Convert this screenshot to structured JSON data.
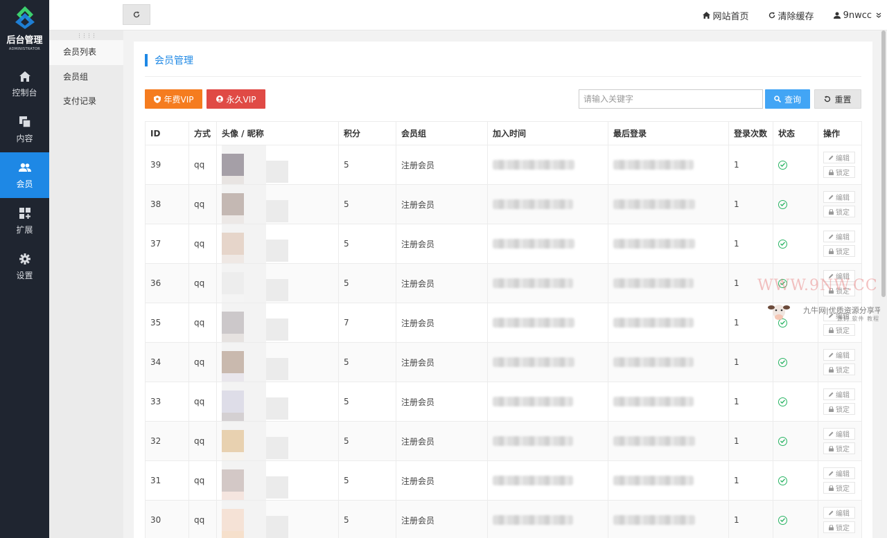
{
  "sidebar": {
    "logo_title": "后台管理",
    "logo_subtitle": "ADMINISTRATOR",
    "items": [
      {
        "label": "控制台",
        "icon": "home-icon"
      },
      {
        "label": "内容",
        "icon": "content-icon"
      },
      {
        "label": "会员",
        "icon": "users-icon",
        "active": true
      },
      {
        "label": "扩展",
        "icon": "extend-icon"
      },
      {
        "label": "设置",
        "icon": "gear-icon"
      }
    ]
  },
  "subnav": {
    "items": [
      {
        "label": "会员列表",
        "active": true
      },
      {
        "label": "会员组"
      },
      {
        "label": "支付记录"
      }
    ]
  },
  "topbar": {
    "home_label": "网站首页",
    "clear_cache_label": "清除缓存",
    "username": "9nwcc"
  },
  "page": {
    "title": "会员管理",
    "btn_year_vip": "年费VIP",
    "btn_perm_vip": "永久VIP",
    "search_placeholder": "请输入关键字",
    "btn_query": "查询",
    "btn_reset": "重置"
  },
  "table": {
    "headers": [
      "ID",
      "方式",
      "头像 / 昵称",
      "积分",
      "会员组",
      "加入时间",
      "最后登录",
      "登录次数",
      "状态",
      "操作"
    ],
    "edit_label": "编辑",
    "lock_label": "锁定",
    "rows": [
      {
        "id": "39",
        "method": "qq",
        "points": "5",
        "group": "注册会员",
        "logins": "1",
        "avatar_color": "#a59fa7",
        "avatar_color2": "#e8e4e2"
      },
      {
        "id": "38",
        "method": "qq",
        "points": "5",
        "group": "注册会员",
        "logins": "1",
        "avatar_color": "#c4b8b3",
        "avatar_color2": "#ece8e6"
      },
      {
        "id": "37",
        "method": "qq",
        "points": "5",
        "group": "注册会员",
        "logins": "1",
        "avatar_color": "#e6d5ca",
        "avatar_color2": "#efe8e4"
      },
      {
        "id": "36",
        "method": "qq",
        "points": "5",
        "group": "注册会员",
        "logins": "1",
        "avatar_color": "#ededed",
        "avatar_color2": "#f4f4f4"
      },
      {
        "id": "35",
        "method": "qq",
        "points": "7",
        "group": "注册会员",
        "logins": "1",
        "avatar_color": "#ccc8ca",
        "avatar_color2": "#e6e2e0"
      },
      {
        "id": "34",
        "method": "qq",
        "points": "5",
        "group": "注册会员",
        "logins": "1",
        "avatar_color": "#c9b9ae",
        "avatar_color2": "#e9e6ec"
      },
      {
        "id": "33",
        "method": "qq",
        "points": "5",
        "group": "注册会员",
        "logins": "1",
        "avatar_color": "#dedde8",
        "avatar_color2": "#d4d0d2"
      },
      {
        "id": "32",
        "method": "qq",
        "points": "5",
        "group": "注册会员",
        "logins": "1",
        "avatar_color": "#e8d1b0",
        "avatar_color2": "#f6f3ee"
      },
      {
        "id": "31",
        "method": "qq",
        "points": "5",
        "group": "注册会员",
        "logins": "1",
        "avatar_color": "#d3c8c6",
        "avatar_color2": "#f5e5df"
      },
      {
        "id": "30",
        "method": "qq",
        "points": "5",
        "group": "注册会员",
        "logins": "1",
        "avatar_color": "#f5e2d6",
        "avatar_color2": "#f6e0cc"
      }
    ]
  },
  "watermark": {
    "url": "WWW.9NW.CC",
    "name": "九牛网|优质资源分享平台",
    "sub": "源码 软件 教程 福利"
  },
  "colors": {
    "sidebar_bg": "#1f2530",
    "accent": "#1e88e5",
    "year_vip": "#f57c1f",
    "perm_vip": "#e04a45",
    "query": "#42a5f5",
    "status_ok": "#28b463"
  }
}
